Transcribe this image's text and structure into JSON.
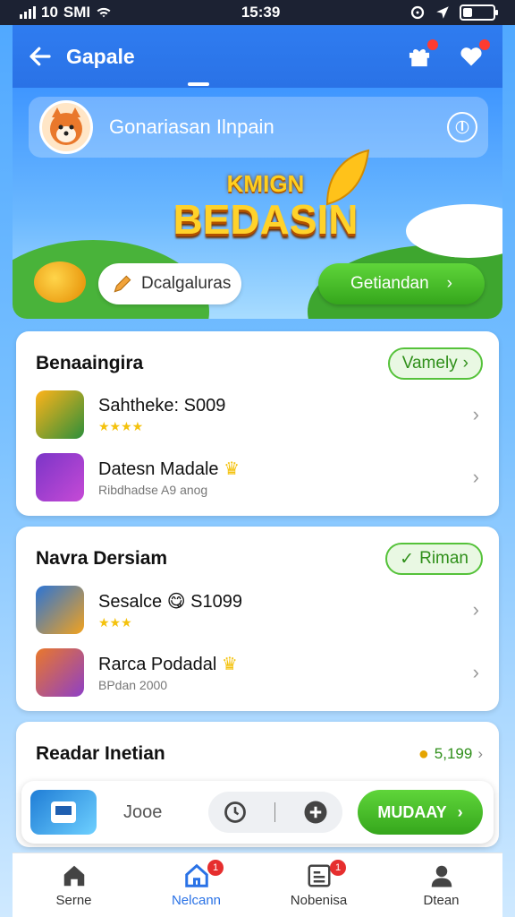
{
  "status": {
    "carrier": "SMI",
    "carrier_prefix": "10",
    "time": "15:39"
  },
  "appbar": {
    "title": "Gapale"
  },
  "hero": {
    "user_name": "Gonariasan Ilnpain",
    "logo_top": "KMIGN",
    "logo_main": "BEDASIN",
    "secondary_button": "Dcalgaluras",
    "primary_button": "Getiandan"
  },
  "section1": {
    "title": "Benaaingira",
    "pill": "Vamely",
    "items": [
      {
        "title": "Sahtheke: S009",
        "sub": "",
        "stars": "★★★★"
      },
      {
        "title": "Datesn Madale",
        "sub": "Ribdhadse A9 anog",
        "stars": ""
      }
    ]
  },
  "section2": {
    "title": "Navra Dersiam",
    "pill": "Riman",
    "items": [
      {
        "title": "Sesalce",
        "price": "S1099",
        "sub": "",
        "stars": "★★★"
      },
      {
        "title": "Rarca Podadal",
        "sub": "BPdan 2000",
        "stars": ""
      }
    ]
  },
  "section3": {
    "title": "Readar Inetian",
    "value": "5,199"
  },
  "action_bar": {
    "label": "Jooe",
    "go_button": "MUDAAY"
  },
  "nav": {
    "items": [
      {
        "label": "Serne",
        "icon": "home-icon",
        "badge": ""
      },
      {
        "label": "Nelcann",
        "icon": "store-icon",
        "badge": "1"
      },
      {
        "label": "Nobenisa",
        "icon": "news-icon",
        "badge": "1"
      },
      {
        "label": "Dtean",
        "icon": "profile-icon",
        "badge": ""
      }
    ]
  },
  "colors": {
    "primary": "#2a72e6",
    "accent_green": "#35a61c",
    "badge_red": "#e62e2e"
  }
}
